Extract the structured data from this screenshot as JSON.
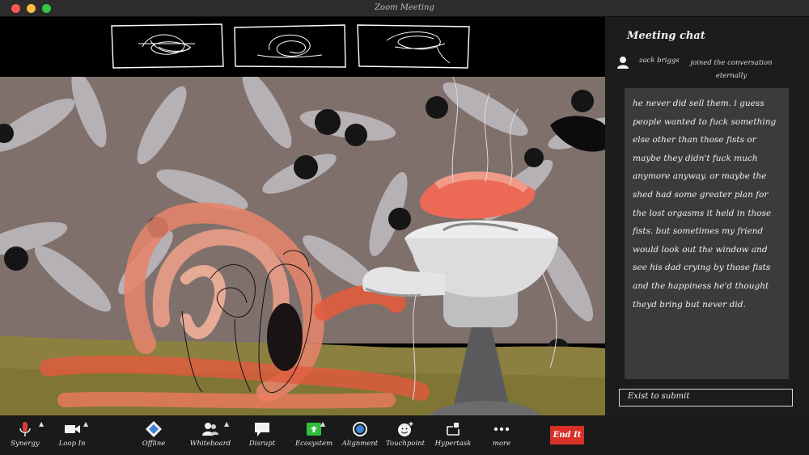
{
  "window": {
    "title": "Zoom Meeting"
  },
  "chat": {
    "title": "Meeting chat",
    "join_name": "zack briggs",
    "join_text": "joined the conversation eternally",
    "message": "he never did sell them. i guess people wanted to fuck something else other than those fists or maybe they didn't fuck much anymore anyway. or maybe the shed had some greater plan for the lost orgasms it held in those fists. but sometimes my friend would look out the window and see his dad crying by those fists and the happiness he'd thought theyd bring but never did.",
    "submit_label": "Exist to submit"
  },
  "toolbar": {
    "synergy": "Synergy",
    "loop_in": "Loop In",
    "offline": "Offline",
    "whiteboard": "Whiteboard",
    "disrupt": "Disrupt",
    "ecosystem": "Ecosystem",
    "alignment": "Alignment",
    "touchpoint": "Touchpoint",
    "hypertask": "Hypertask",
    "more": "more",
    "end": "End It"
  },
  "icons": {
    "mic": "microphone-icon",
    "video": "video-camera-icon",
    "offline": "diamond-icon",
    "whiteboard": "participants-icon",
    "disrupt": "speech-bubble-icon",
    "ecosystem": "share-screen-icon",
    "alignment": "circle-icon",
    "touchpoint": "reaction-icon",
    "hypertask": "apps-icon",
    "more": "ellipsis-icon"
  },
  "colors": {
    "end_button": "#d63027",
    "share_green": "#2fbf3c",
    "mic_red": "#e03b3b",
    "chat_bubble": "#3b3b3b"
  }
}
